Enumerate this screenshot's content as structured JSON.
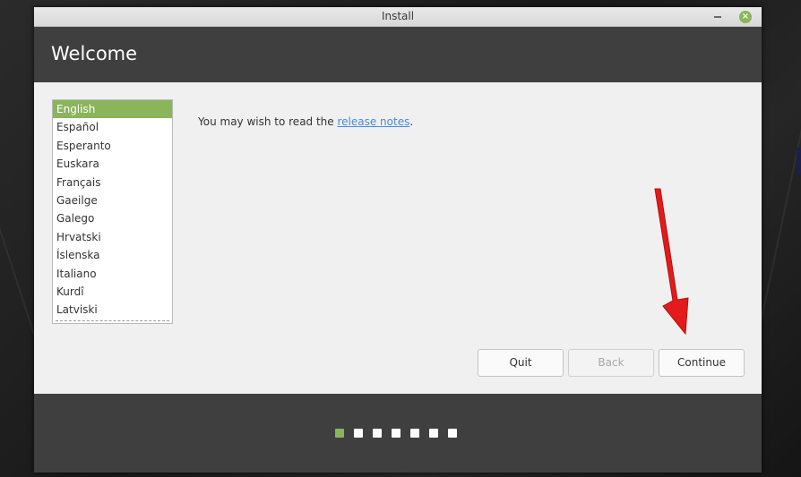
{
  "window": {
    "title": "Install",
    "minimize_glyph": "",
    "close_glyph": "×"
  },
  "header": {
    "title": "Welcome"
  },
  "languages": {
    "items": [
      "English",
      "Español",
      "Esperanto",
      "Euskara",
      "Français",
      "Gaeilge",
      "Galego",
      "Hrvatski",
      "Íslenska",
      "Italiano",
      "Kurdî",
      "Latviski"
    ],
    "selected": "English"
  },
  "release": {
    "prefix": "You may wish to read the ",
    "link": "release notes",
    "suffix": "."
  },
  "buttons": {
    "quit": "Quit",
    "back": "Back",
    "continue": "Continue"
  },
  "progress": {
    "total_steps": 7,
    "current_step": 1
  },
  "colors": {
    "accent": "#8ab55b",
    "header_bg": "#3f3f3f",
    "link": "#4a8ad6",
    "annotation_arrow": "#e31b1b"
  },
  "icons": {
    "minimize": "minimize-icon",
    "close": "close-icon",
    "annotation": "red-arrow-icon"
  }
}
